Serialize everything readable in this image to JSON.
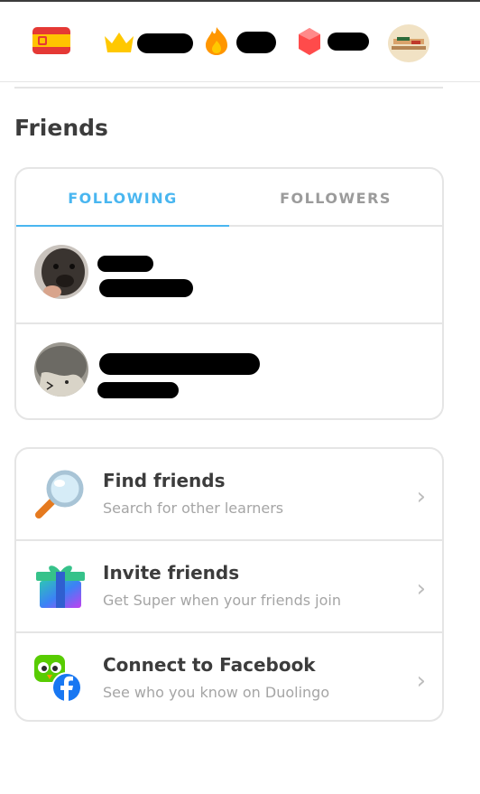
{
  "colors": {
    "accent": "#49b6f0",
    "border": "#e5e5e5",
    "text": "#3c3c3c",
    "muted": "#a5a5a5"
  },
  "topbar": {
    "language_flag_icon": "spain-flag-icon",
    "crowns_icon": "crown-icon",
    "streak_icon": "fire-icon",
    "gems_icon": "gem-icon",
    "avatar_icon": "profile-avatar"
  },
  "friends": {
    "heading": "Friends",
    "tabs": [
      {
        "label": "FOLLOWING",
        "active": true
      },
      {
        "label": "FOLLOWERS",
        "active": false
      }
    ],
    "following": [
      {
        "avatar": "dog-avatar"
      },
      {
        "avatar": "hedgehog-avatar"
      }
    ]
  },
  "actions": [
    {
      "title": "Find friends",
      "subtitle": "Search for other learners",
      "icon": "magnifier-icon"
    },
    {
      "title": "Invite friends",
      "subtitle": "Get Super when your friends join",
      "icon": "gift-icon"
    },
    {
      "title": "Connect to Facebook",
      "subtitle": "See who you know on Duolingo",
      "icon": "facebook-icon"
    }
  ]
}
